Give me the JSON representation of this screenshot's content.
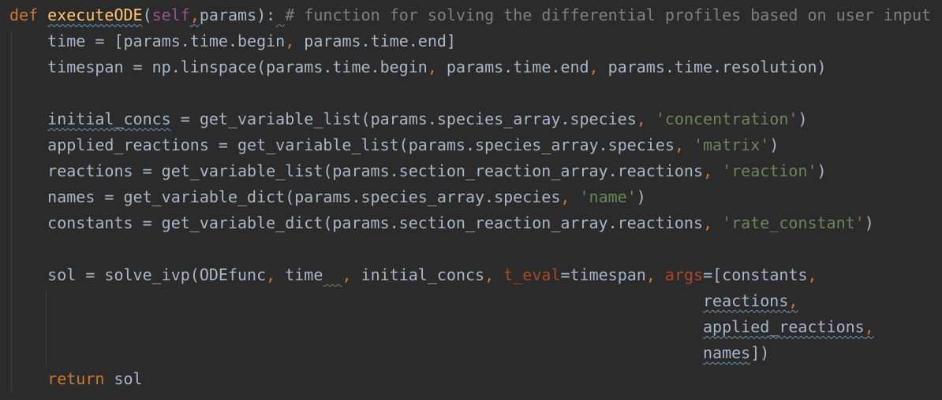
{
  "editor": {
    "language": "Python",
    "lines": [
      {
        "n": 1,
        "tokens": [
          {
            "t": "def ",
            "c": "kw"
          },
          {
            "t": "executeODE",
            "c": "fn typo"
          },
          {
            "t": "(",
            "c": ""
          },
          {
            "t": "self",
            "c": "self"
          },
          {
            "t": ",",
            "c": "kw typo"
          },
          {
            "t": "params",
            "c": ""
          },
          {
            "t": "):",
            "c": ""
          },
          {
            "t": " ",
            "c": "warn"
          },
          {
            "t": "# function for solving the differential profiles based on user input",
            "c": "cm"
          }
        ]
      },
      {
        "n": 2,
        "tokens": [
          {
            "t": "    time = [params.time.begin",
            "c": ""
          },
          {
            "t": ", ",
            "c": "kw"
          },
          {
            "t": "params.time.end]",
            "c": ""
          }
        ]
      },
      {
        "n": 3,
        "tokens": [
          {
            "t": "    timespan = np.linspace(params.time.begin",
            "c": ""
          },
          {
            "t": ", ",
            "c": "kw"
          },
          {
            "t": "params.time.end",
            "c": ""
          },
          {
            "t": ", ",
            "c": "kw"
          },
          {
            "t": "params.time.resolution)",
            "c": ""
          }
        ]
      },
      {
        "n": 4,
        "tokens": []
      },
      {
        "n": 5,
        "tokens": [
          {
            "t": "    ",
            "c": ""
          },
          {
            "t": "initial_concs",
            "c": "typo"
          },
          {
            "t": " = get_variable_list(params.species_array.species",
            "c": ""
          },
          {
            "t": ", ",
            "c": "kw"
          },
          {
            "t": "'concentration'",
            "c": "str"
          },
          {
            "t": ")",
            "c": ""
          }
        ]
      },
      {
        "n": 6,
        "tokens": [
          {
            "t": "    applied_reactions = get_variable_list(params.species_array.species",
            "c": ""
          },
          {
            "t": ", ",
            "c": "kw"
          },
          {
            "t": "'matrix'",
            "c": "str"
          },
          {
            "t": ")",
            "c": ""
          }
        ]
      },
      {
        "n": 7,
        "tokens": [
          {
            "t": "    reactions = get_variable_list(params.section_reaction_array.reactions",
            "c": ""
          },
          {
            "t": ", ",
            "c": "kw"
          },
          {
            "t": "'reaction'",
            "c": "str"
          },
          {
            "t": ")",
            "c": ""
          }
        ]
      },
      {
        "n": 8,
        "tokens": [
          {
            "t": "    names = get_variable_dict(params.species_array.species",
            "c": ""
          },
          {
            "t": ", ",
            "c": "kw"
          },
          {
            "t": "'name'",
            "c": "str"
          },
          {
            "t": ")",
            "c": ""
          }
        ]
      },
      {
        "n": 9,
        "tokens": [
          {
            "t": "    constants = get_variable_dict(params.section_reaction_array.reactions",
            "c": ""
          },
          {
            "t": ", ",
            "c": "kw"
          },
          {
            "t": "'rate_constant'",
            "c": "str"
          },
          {
            "t": ")",
            "c": ""
          }
        ]
      },
      {
        "n": 10,
        "tokens": []
      },
      {
        "n": 11,
        "tokens": [
          {
            "t": "    sol = solve_ivp(ODEfunc",
            "c": ""
          },
          {
            "t": ", ",
            "c": "kw"
          },
          {
            "t": "time",
            "c": ""
          },
          {
            "t": "  ",
            "c": "warn"
          },
          {
            "t": ", ",
            "c": "kw"
          },
          {
            "t": "initial_concs",
            "c": ""
          },
          {
            "t": ", ",
            "c": "kw"
          },
          {
            "t": "t_eval",
            "c": "pn"
          },
          {
            "t": "=timespan",
            "c": ""
          },
          {
            "t": ", ",
            "c": "kw"
          },
          {
            "t": "args",
            "c": "pn"
          },
          {
            "t": "=[constants",
            "c": ""
          },
          {
            "t": ",",
            "c": "kw"
          }
        ]
      },
      {
        "n": 12,
        "tokens": [
          {
            "t": "                                                                         ",
            "c": ""
          },
          {
            "t": "reactions",
            "c": "typo"
          },
          {
            "t": ",",
            "c": "kw typo"
          }
        ]
      },
      {
        "n": 13,
        "tokens": [
          {
            "t": "                                                                         ",
            "c": ""
          },
          {
            "t": "applied_reactions",
            "c": "typo"
          },
          {
            "t": ",",
            "c": "kw typo"
          }
        ]
      },
      {
        "n": 14,
        "tokens": [
          {
            "t": "                                                                         ",
            "c": ""
          },
          {
            "t": "names",
            "c": "typo"
          },
          {
            "t": "])",
            "c": ""
          }
        ]
      },
      {
        "n": 15,
        "tokens": [
          {
            "t": "    ",
            "c": ""
          },
          {
            "t": "return",
            "c": "kw"
          },
          {
            "t": " sol",
            "c": ""
          }
        ]
      }
    ]
  }
}
